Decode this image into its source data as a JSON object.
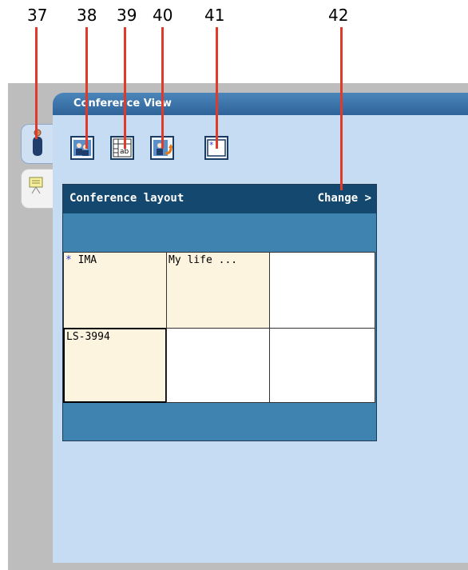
{
  "callouts": [
    {
      "number": "37"
    },
    {
      "number": "38"
    },
    {
      "number": "39"
    },
    {
      "number": "40"
    },
    {
      "number": "41"
    },
    {
      "number": "42"
    }
  ],
  "panel": {
    "title": "Conference View"
  },
  "side_tabs": [
    {
      "icon": "person-icon"
    },
    {
      "icon": "presentation-icon"
    }
  ],
  "toolbar": [
    {
      "icon": "participants-icon"
    },
    {
      "icon": "text-grid-icon"
    },
    {
      "icon": "participant-swap-icon"
    },
    {
      "icon": "window-star-icon"
    }
  ],
  "layout": {
    "title": "Conference layout",
    "change_label": "Change >",
    "cells": [
      {
        "text": "IMA",
        "marker": "*",
        "filled": true
      },
      {
        "text": "My life ...",
        "filled": true
      },
      {
        "text": "",
        "filled": false
      },
      {
        "text": "LS-3994",
        "filled": true,
        "selected": true
      },
      {
        "text": "",
        "filled": false
      },
      {
        "text": "",
        "filled": false
      }
    ]
  },
  "colors": {
    "callout_line": "#e03a2a",
    "panel_bg": "#c5dcf3",
    "header_bg": "#14486e",
    "cell_filled": "#fdf4e0"
  }
}
